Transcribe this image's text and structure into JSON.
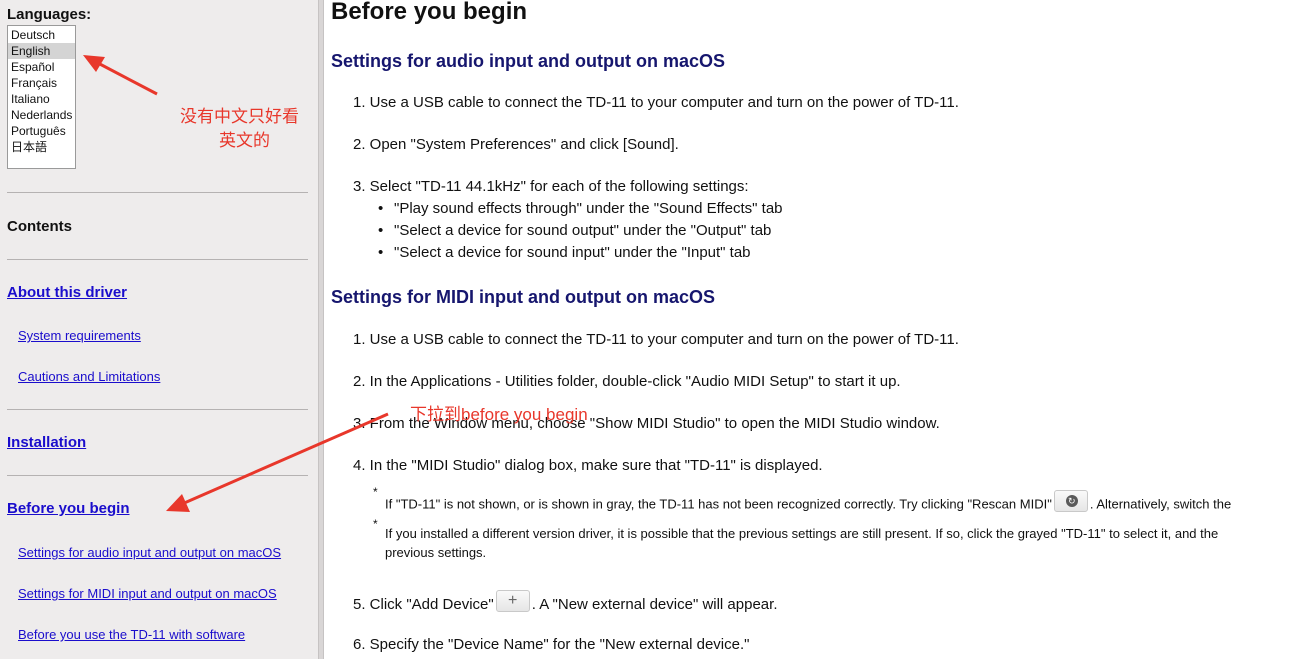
{
  "sidebar": {
    "languages_label": "Languages:",
    "languages": [
      "Deutsch",
      "English",
      "Español",
      "Français",
      "Italiano",
      "Nederlands",
      "Português",
      "日本語"
    ],
    "selected_language": "English",
    "contents_label": "Contents",
    "nav": {
      "about": "About this driver",
      "system_requirements": "System requirements",
      "cautions": "Cautions and Limitations",
      "installation": "Installation",
      "before_you_begin": "Before you begin",
      "audio_settings": "Settings for audio input and output on macOS",
      "midi_settings": "Settings for MIDI input and output on macOS",
      "before_software": "Before you use the TD-11 with software"
    }
  },
  "main": {
    "title": "Before you begin",
    "audio_section": {
      "heading": "Settings for audio input and output on macOS",
      "step1": "1. Use a USB cable to connect the TD-11 to your computer and turn on the power of TD-11.",
      "step2": "2. Open \"System Preferences\" and click [Sound].",
      "step3": "3. Select \"TD-11 44.1kHz\" for each of the following settings:",
      "bullets": [
        "\"Play sound effects through\" under the \"Sound Effects\" tab",
        "\"Select a device for sound output\" under the \"Output\" tab",
        "\"Select a device for sound input\" under the \"Input\" tab"
      ]
    },
    "midi_section": {
      "heading": "Settings for MIDI input and output on macOS",
      "step1": "1. Use a USB cable to connect the TD-11 to your computer and turn on the power of TD-11.",
      "step2": "2. In the Applications - Utilities folder, double-click \"Audio MIDI Setup\" to start it up.",
      "step3": "3. From the Window menu, choose \"Show MIDI Studio\" to open the MIDI Studio window.",
      "step4": "4. In the \"MIDI Studio\" dialog box, make sure that \"TD-11\" is displayed.",
      "note_star": "*",
      "note1_before": "If \"TD-11\" is not shown, or is shown in gray, the TD-11 has not been recognized correctly. Try clicking \"Rescan MIDI\"",
      "note1_after": ". Alternatively, switch the",
      "note2_line1": "If you installed a different version driver, it is possible that the previous settings are still present. If so, click the grayed \"TD-11\" to select it, and the",
      "note2_line2": "previous settings.",
      "step5_before": "5. Click \"Add Device\"",
      "step5_after": ". A \"New external device\" will appear.",
      "add_icon_glyph": "+",
      "step6": "6. Specify the \"Device Name\" for the \"New external device.\""
    }
  },
  "annotations": {
    "note1_line1": "没有中文只好看",
    "note1_line2": "英文的",
    "note2": "下拉到before you begin",
    "color": "#e8372b"
  }
}
